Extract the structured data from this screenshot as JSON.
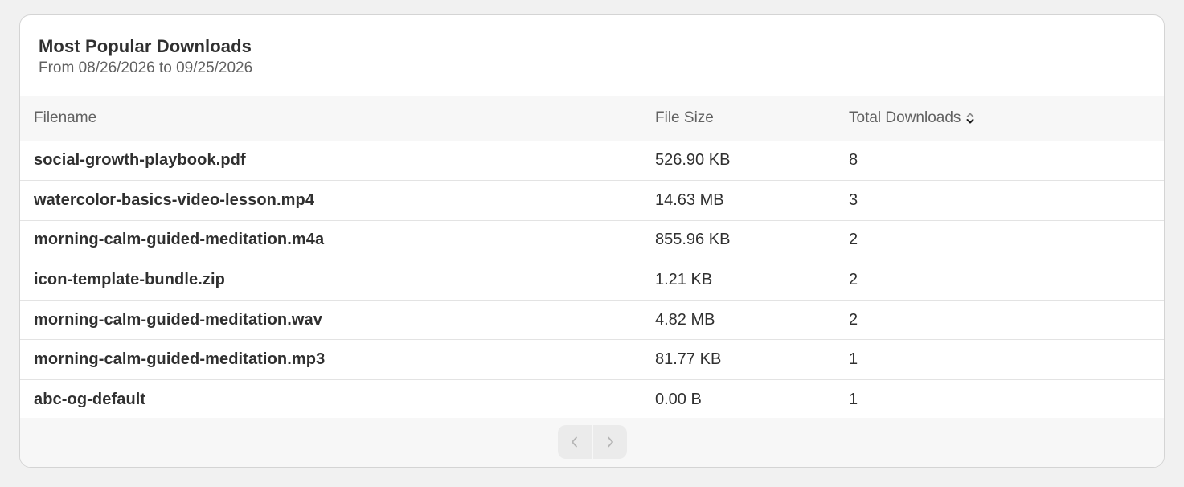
{
  "card": {
    "title": "Most Popular Downloads",
    "subtitle": "From 08/26/2026 to 09/25/2026"
  },
  "table": {
    "columns": [
      "Filename",
      "File Size",
      "Total Downloads"
    ],
    "rows": [
      {
        "filename": "social-growth-playbook.pdf",
        "size": "526.90 KB",
        "downloads": "8"
      },
      {
        "filename": "watercolor-basics-video-lesson.mp4",
        "size": "14.63 MB",
        "downloads": "3"
      },
      {
        "filename": "morning-calm-guided-meditation.m4a",
        "size": "855.96 KB",
        "downloads": "2"
      },
      {
        "filename": "icon-template-bundle.zip",
        "size": "1.21 KB",
        "downloads": "2"
      },
      {
        "filename": "morning-calm-guided-meditation.wav",
        "size": "4.82 MB",
        "downloads": "2"
      },
      {
        "filename": "morning-calm-guided-meditation.mp3",
        "size": "81.77 KB",
        "downloads": "1"
      },
      {
        "filename": "abc-og-default",
        "size": "0.00 B",
        "downloads": "1"
      }
    ]
  },
  "icons": {
    "sort": "sort-icon",
    "prev": "chevron-left-icon",
    "next": "chevron-right-icon"
  },
  "colors": {
    "text": "#303030",
    "muted": "#616161",
    "header_bg": "#f7f7f7",
    "border": "#e3e3e3",
    "page_bg": "#f1f1f1"
  }
}
